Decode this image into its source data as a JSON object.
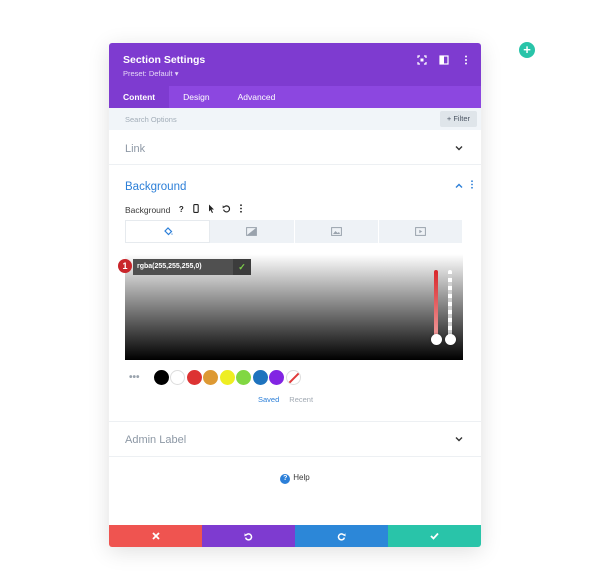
{
  "modal": {
    "title": "Section Settings",
    "preset": "Preset: Default ▾",
    "header_icons": [
      "focus-icon",
      "split-view-icon",
      "more-vertical-icon"
    ]
  },
  "tabs": [
    {
      "label": "Content",
      "active": true
    },
    {
      "label": "Design",
      "active": false
    },
    {
      "label": "Advanced",
      "active": false
    }
  ],
  "search": {
    "placeholder": "Search Options",
    "filter_label": "+ Filter"
  },
  "sections": {
    "link": {
      "title": "Link"
    },
    "background": {
      "title": "Background",
      "field_label": "Background",
      "type_tabs": [
        "color",
        "gradient",
        "image",
        "video"
      ],
      "color_value": "rgba(255,255,255,0)",
      "marker": "1",
      "swatches": [
        "#000000",
        "#ffffff",
        "#dd3333",
        "#dd9933",
        "#eeee22",
        "#81d742",
        "#1e73be",
        "#8224e3"
      ],
      "saved_label": "Saved",
      "recent_label": "Recent"
    },
    "admin_label": {
      "title": "Admin Label"
    }
  },
  "help": {
    "label": "Help"
  },
  "footer": {
    "colors": {
      "cancel": "#ef5450",
      "undo": "#7e3bd0",
      "redo": "#2c87d8",
      "save": "#29c4a9"
    }
  },
  "colors": {
    "header": "#7e3bd0",
    "accent": "#2c7fd8",
    "fab": "#29c4a9"
  }
}
